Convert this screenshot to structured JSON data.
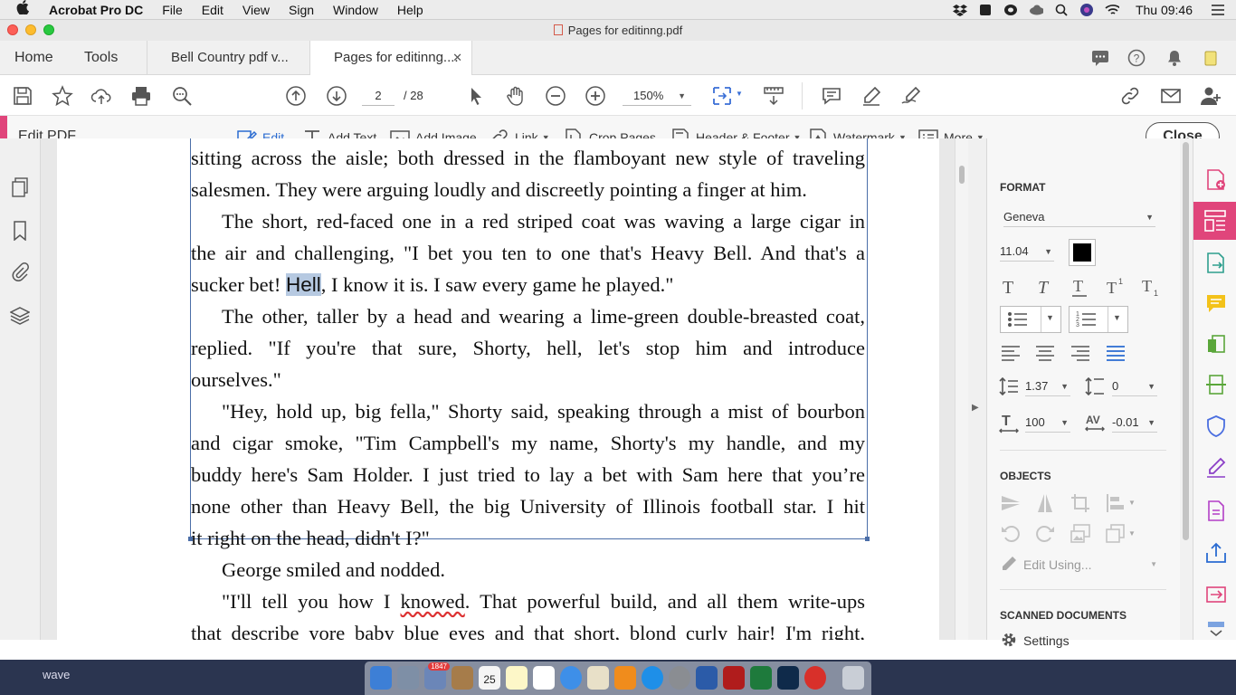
{
  "menubar": {
    "app": "Acrobat Pro DC",
    "items": [
      "File",
      "Edit",
      "View",
      "Sign",
      "Window",
      "Help"
    ],
    "clock": "Thu 09:46"
  },
  "window": {
    "title": "Pages for editinng.pdf"
  },
  "tabs": {
    "home": "Home",
    "tools": "Tools",
    "docs": [
      "Bell Country pdf v...",
      "Pages for editinng...."
    ]
  },
  "toolbar": {
    "page_current": "2",
    "page_total": "/ 28",
    "zoom": "150%"
  },
  "editbar": {
    "title": "Edit PDF",
    "tools": [
      "Edit",
      "Add Text",
      "Add Image",
      "Link",
      "Crop Pages",
      "Header & Footer",
      "Watermark",
      "More"
    ],
    "close": "Close"
  },
  "document": {
    "lines": [
      "sitting across the aisle; both dressed in the flamboyant new style of traveling",
      "salesmen. They were arguing loudly and discreetly pointing a finger at him.",
      "The short, red-faced one in a red striped coat was waving a large cigar in",
      "the air and challenging, \"I bet you ten to one that's Heavy Bell. And that's a",
      "sucker bet!",
      "Hell",
      ", I know it is. I saw every game he played.\"",
      "The other, taller by a head and wearing a lime-green double-breasted coat,",
      "replied. \"If you're that sure, Shorty, hell, let's stop him and introduce",
      "ourselves.\"",
      "\"Hey, hold up, big fella,\" Shorty said, speaking through a mist of bourbon",
      "and cigar smoke, \"Tim Campbell's my name, Shorty's my handle, and my",
      "buddy here's Sam Holder. I just tried to lay a bet with Sam here that you’re",
      "none other than Heavy Bell, the big University of Illinois football star. I hit",
      "it right on the head, didn't I?\"",
      "George smiled and nodded.",
      "\"I'll tell you how I",
      "knowed",
      ". That powerful build, and all them write-ups",
      "that describe yore baby blue eyes and that short, blond curly hair! I'm right,"
    ]
  },
  "format_panel": {
    "heading": "FORMAT",
    "font": "Geneva",
    "size": "11.04",
    "color": "#000000",
    "line_spacing": "1.37",
    "para_spacing": "0",
    "scale": "100",
    "char_spacing": "-0.01"
  },
  "objects_panel": {
    "heading": "OBJECTS",
    "edit_using": "Edit Using..."
  },
  "scanned_panel": {
    "heading": "SCANNED DOCUMENTS",
    "settings": "Settings"
  },
  "dock": {
    "label": "wave",
    "badge": "1847",
    "calendar_day": "25"
  },
  "colors": {
    "accent": "#e0457b",
    "selection": "#b6c9e1",
    "textbox_border": "#4b6ea8"
  }
}
